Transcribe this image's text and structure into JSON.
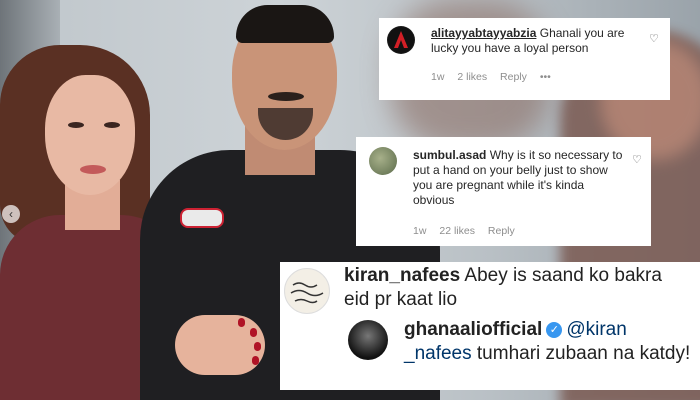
{
  "comments": [
    {
      "username": "alitayyabtayyabzia",
      "text": "Ghanali you are lucky you have a loyal person",
      "time": "1w",
      "likes": "2 likes",
      "reply": "Reply",
      "more": "•••",
      "avatar_color": "#d21f26"
    },
    {
      "username": "sumbul.asad",
      "text": "Why is it so necessary to put a hand on your belly just to show you are pregnant while it's kinda obvious",
      "time": "1w",
      "likes": "22 likes",
      "reply": "Reply"
    },
    {
      "username": "kiran_nafees",
      "text": "Abey is saand ko bakra eid pr kaat lio",
      "reply_username": "ghanaaliofficial",
      "reply_mention": "@kiran _nafees",
      "reply_text": "tumhari zubaan na katdy!"
    }
  ],
  "icons": {
    "heart": "♡",
    "verified": "✓",
    "carousel_prev": "‹"
  },
  "colors": {
    "username": "#262626",
    "meta": "#8e8e8e",
    "verified": "#3897f0",
    "mention": "#003569"
  }
}
